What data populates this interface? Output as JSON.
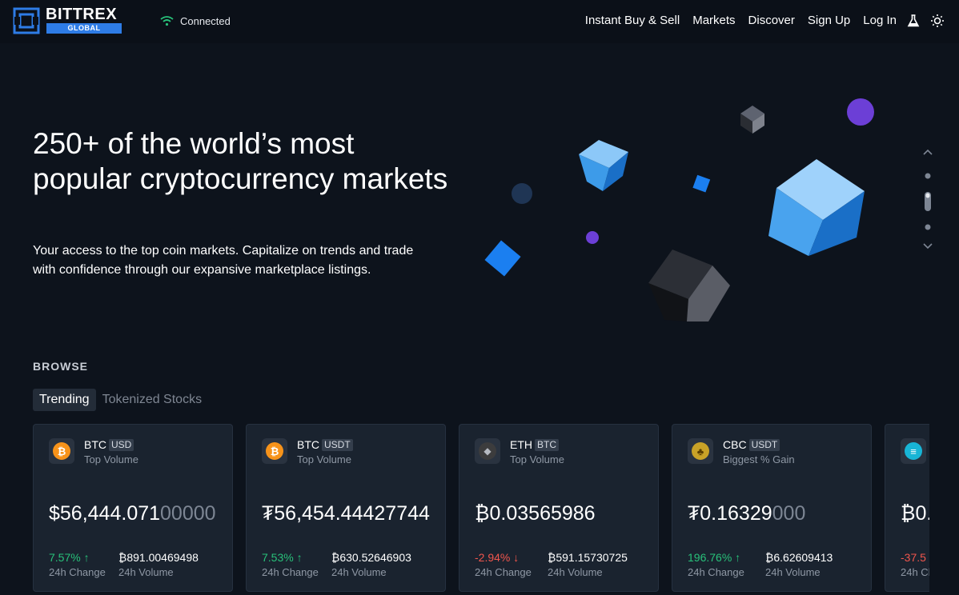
{
  "brand": {
    "name": "BITTREX",
    "sub": "GLOBAL",
    "accent": "#2e7ce6"
  },
  "status": {
    "label": "Connected",
    "icon": "wifi-icon",
    "color": "#28c17a"
  },
  "nav": {
    "items": [
      "Instant Buy & Sell",
      "Markets",
      "Discover",
      "Sign Up",
      "Log In"
    ],
    "icons": [
      "flask-icon",
      "sun-icon"
    ]
  },
  "hero": {
    "title": "250+ of the world’s most popular cryptocurrency markets",
    "subtitle": "Your access to the top coin markets. Capitalize on trends and trade with confidence through our expansive marketplace listings."
  },
  "browse": {
    "heading": "BROWSE",
    "tabs": [
      {
        "label": "Trending",
        "active": true
      },
      {
        "label": "Tokenized Stocks",
        "active": false
      }
    ]
  },
  "cards": [
    {
      "base": "BTC",
      "quote": "USD",
      "tag": "Top Volume",
      "price_main": "$56,444.071",
      "price_dim": "00000",
      "change": "7.57% ↑",
      "direction": "up",
      "change_label": "24h Change",
      "volume": "₿891.00469498",
      "volume_label": "24h Volume",
      "icon": "bitcoin-icon",
      "color": "#f7931a",
      "glyph": "₿"
    },
    {
      "base": "BTC",
      "quote": "USDT",
      "tag": "Top Volume",
      "price_main": "₮56,454.44427744",
      "price_dim": "",
      "change": "7.53% ↑",
      "direction": "up",
      "change_label": "24h Change",
      "volume": "₿630.52646903",
      "volume_label": "24h Volume",
      "icon": "bitcoin-icon",
      "color": "#f7931a",
      "glyph": "₿"
    },
    {
      "base": "ETH",
      "quote": "BTC",
      "tag": "Top Volume",
      "price_main": "₿0.03565986",
      "price_dim": "",
      "change": "-2.94% ↓",
      "direction": "down",
      "change_label": "24h Change",
      "volume": "₿591.15730725",
      "volume_label": "24h Volume",
      "icon": "ethereum-icon",
      "color": "#3c3c3d",
      "glyph": "◆"
    },
    {
      "base": "CBC",
      "quote": "USDT",
      "tag": "Biggest % Gain",
      "price_main": "₮0.16329",
      "price_dim": "000",
      "change": "196.76% ↑",
      "direction": "up",
      "change_label": "24h Change",
      "volume": "₿6.62609413",
      "volume_label": "24h Volume",
      "icon": "cbc-coin-icon",
      "color": "#c9a227",
      "glyph": "♣"
    },
    {
      "base": "",
      "quote": "",
      "tag": "",
      "price_main": "₿0.",
      "price_dim": "",
      "change": "-37.5",
      "direction": "down",
      "change_label": "24h Ch",
      "volume": "",
      "volume_label": "",
      "icon": "coin-icon",
      "color": "#18b5d6",
      "glyph": "≡"
    }
  ]
}
